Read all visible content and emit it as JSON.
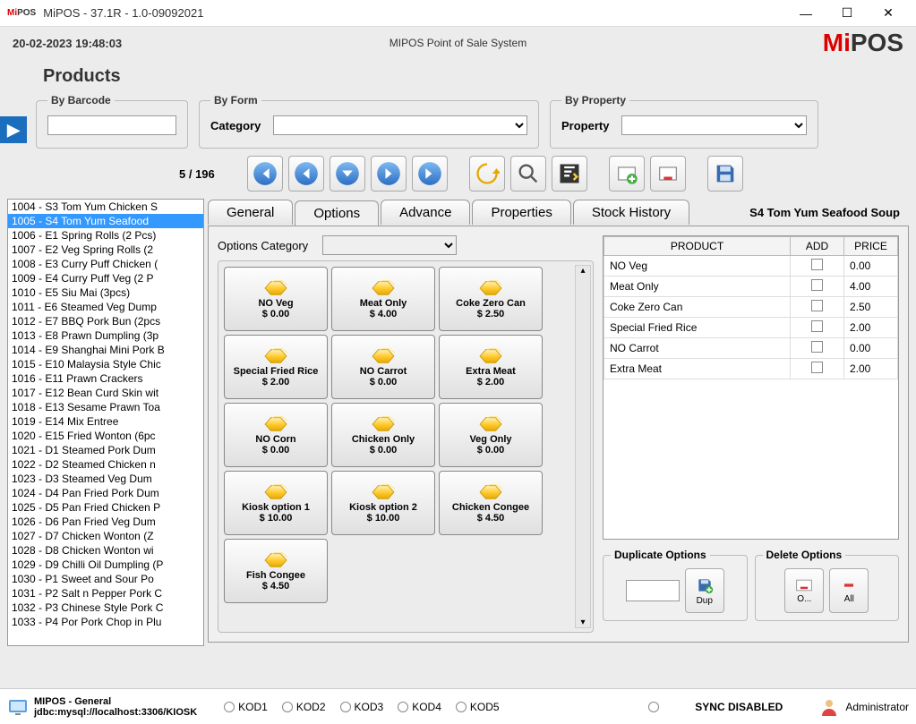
{
  "window_title": "MiPOS - 37.1R - 1.0-09092021",
  "datetime": "20-02-2023 19:48:03",
  "subtitle": "MIPOS Point of Sale System",
  "brand_mi": "Mi",
  "brand_pos": "POS",
  "page_title": "Products",
  "filters": {
    "barcode_legend": "By Barcode",
    "form_legend": "By Form",
    "form_label": "Category",
    "property_legend": "By Property",
    "property_label": "Property"
  },
  "counter": "5  /  196",
  "tabs": {
    "general": "General",
    "options": "Options",
    "advance": "Advance",
    "properties": "Properties",
    "stock": "Stock History"
  },
  "current_product": "S4 Tom Yum Seafood Soup",
  "options_cat_label": "Options Category",
  "product_list": [
    "1004 - S3 Tom Yum Chicken S",
    "1005 - S4 Tom Yum Seafood",
    "1006 - E1 Spring Rolls (2 Pcs)",
    "1007 - E2 Veg Spring Rolls (2",
    "1008 - E3 Curry Puff Chicken (",
    "1009 - E4 Curry Puff Veg (2 P",
    "1010 - E5 Siu Mai (3pcs)",
    "1011 - E6 Steamed Veg Dump",
    "1012 - E7 BBQ Pork Bun (2pcs",
    "1013 - E8 Prawn Dumpling (3p",
    "1014 - E9 Shanghai Mini Pork B",
    "1015 - E10 Malaysia Style Chic",
    "1016 - E11 Prawn Crackers",
    "1017 - E12 Bean Curd Skin wit",
    "1018 - E13 Sesame Prawn Toa",
    "1019 - E14 Mix Entree",
    "1020 - E15 Fried Wonton (6pc",
    "1021 - D1 Steamed Pork Dum",
    "1022 - D2 Steamed Chicken n",
    "1023 - D3 Steamed  Veg Dum",
    "1024 - D4 Pan Fried Pork Dum",
    "1025 - D5 Pan Fried Chicken P",
    "1026 - D6 Pan Fried  Veg Dum",
    "1027 - D7 Chicken Wonton (Z",
    "1028 - D8 Chicken Wonton wi",
    "1029 - D9 Chilli Oil Dumpling (P",
    "1030 - P1 Sweet and Sour Po",
    "1031 - P2 Salt n Pepper Pork C",
    "1032 - P3 Chinese Style Pork C",
    "1033 - P4 Por Pork Chop in Plu"
  ],
  "selected_index": 1,
  "option_tiles": [
    {
      "name": "NO Veg",
      "price": "$ 0.00"
    },
    {
      "name": "Meat Only",
      "price": "$ 4.00"
    },
    {
      "name": "Coke Zero Can",
      "price": "$ 2.50"
    },
    {
      "name": "Special Fried Rice",
      "price": "$ 2.00"
    },
    {
      "name": "NO Carrot",
      "price": "$ 0.00"
    },
    {
      "name": "Extra Meat",
      "price": "$ 2.00"
    },
    {
      "name": "NO Corn",
      "price": "$ 0.00"
    },
    {
      "name": "Chicken Only",
      "price": "$ 0.00"
    },
    {
      "name": "Veg Only",
      "price": "$ 0.00"
    },
    {
      "name": "Kiosk option 1",
      "price": "$ 10.00"
    },
    {
      "name": "Kiosk option 2",
      "price": "$ 10.00"
    },
    {
      "name": "Chicken Congee",
      "price": "$ 4.50"
    },
    {
      "name": "Fish Congee",
      "price": "$ 4.50"
    }
  ],
  "table_headers": {
    "product": "PRODUCT",
    "add": "ADD",
    "price": "PRICE"
  },
  "table_rows": [
    {
      "product": "NO Veg",
      "price": "0.00"
    },
    {
      "product": "Meat Only",
      "price": "4.00"
    },
    {
      "product": "Coke Zero Can",
      "price": "2.50"
    },
    {
      "product": "Special Fried Rice",
      "price": "2.00"
    },
    {
      "product": "NO Carrot",
      "price": "0.00"
    },
    {
      "product": "Extra Meat",
      "price": "2.00"
    }
  ],
  "dup_legend": "Duplicate Options",
  "dup_btn": "Dup",
  "del_legend": "Delete Options",
  "del_one": "O...",
  "del_all": "All",
  "status": {
    "app": "MIPOS - General",
    "conn": "jdbc:mysql://localhost:3306/KIOSK",
    "kods": [
      "KOD1",
      "KOD2",
      "KOD3",
      "KOD4",
      "KOD5"
    ],
    "sync": "SYNC DISABLED",
    "user": "Administrator"
  }
}
